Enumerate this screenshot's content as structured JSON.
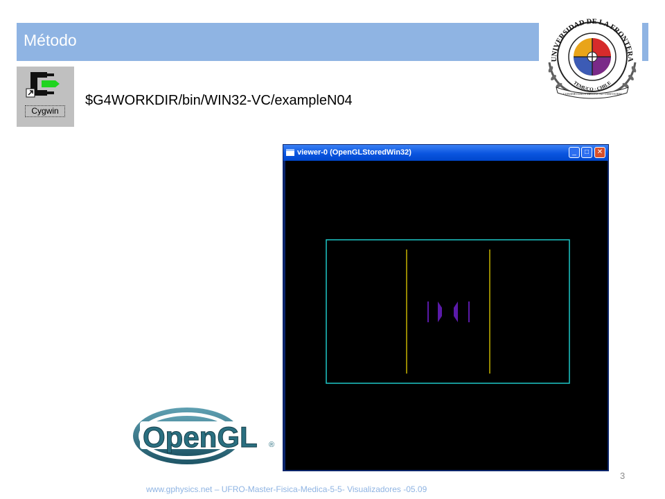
{
  "slide": {
    "title": "Método",
    "command": "$G4WORKDIR/bin/WIN32-VC/exampleN04",
    "slide_number": "3",
    "footer": "www.gphysics.net – UFRO-Master-Fisica-Medica-5-5- Visualizadores -05.09"
  },
  "cygwin_shortcut": {
    "label": "Cygwin",
    "icon": "cygwin-icon"
  },
  "seal": {
    "text_top": "UNIVERSIDAD DE LA FRONTERA",
    "text_bottom": "TEMUCO · CHILE",
    "motto": "CONSERVAMUS MENTIS AD VERITATEM"
  },
  "viewer": {
    "title": "viewer-0 (OpenGLStoredWin32)",
    "minimize_symbol": "_",
    "maximize_symbol": "□",
    "close_symbol": "✕",
    "colors": {
      "world_box": "#1ec8c8",
      "detector_planes": "#c8b400",
      "target": "#5a1aa8"
    }
  },
  "opengl_logo": {
    "text": "OpenGL",
    "registered": "®"
  },
  "colors": {
    "accent": "#8fb4e3",
    "window_blue": "#0a55e0"
  }
}
